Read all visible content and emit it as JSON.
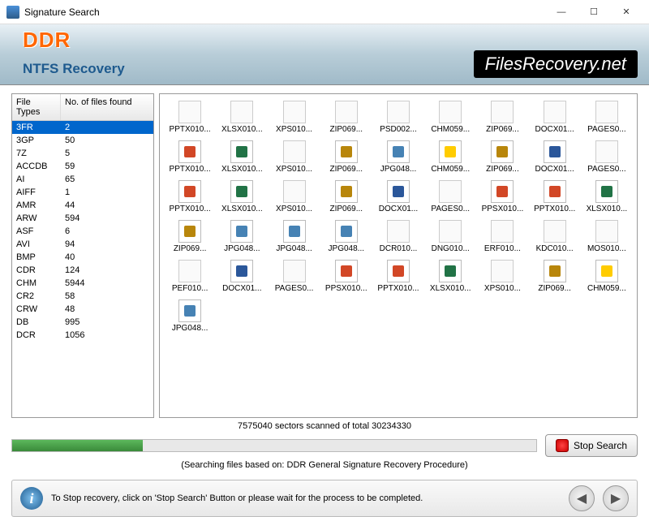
{
  "window": {
    "title": "Signature Search"
  },
  "brand": {
    "ddr": "DDR",
    "product": "NTFS Recovery",
    "site": "FilesRecovery.net"
  },
  "table": {
    "col1": "File Types",
    "col2": "No. of files found",
    "rows": [
      {
        "t": "3FR",
        "n": "2",
        "sel": true
      },
      {
        "t": "3GP",
        "n": "50"
      },
      {
        "t": "7Z",
        "n": "5"
      },
      {
        "t": "ACCDB",
        "n": "59"
      },
      {
        "t": "AI",
        "n": "65"
      },
      {
        "t": "AIFF",
        "n": "1"
      },
      {
        "t": "AMR",
        "n": "44"
      },
      {
        "t": "ARW",
        "n": "594"
      },
      {
        "t": "ASF",
        "n": "6"
      },
      {
        "t": "AVI",
        "n": "94"
      },
      {
        "t": "BMP",
        "n": "40"
      },
      {
        "t": "CDR",
        "n": "124"
      },
      {
        "t": "CHM",
        "n": "5944"
      },
      {
        "t": "CR2",
        "n": "58"
      },
      {
        "t": "CRW",
        "n": "48"
      },
      {
        "t": "DB",
        "n": "995"
      },
      {
        "t": "DCR",
        "n": "1056"
      }
    ]
  },
  "files": [
    {
      "n": "PPTX010...",
      "c": "blank"
    },
    {
      "n": "XLSX010...",
      "c": "blank"
    },
    {
      "n": "XPS010...",
      "c": "blank"
    },
    {
      "n": "ZIP069...",
      "c": "blank"
    },
    {
      "n": "PSD002...",
      "c": "blank"
    },
    {
      "n": "CHM059...",
      "c": "blank"
    },
    {
      "n": "ZIP069...",
      "c": "blank"
    },
    {
      "n": "DOCX01...",
      "c": "blank"
    },
    {
      "n": "PAGES0...",
      "c": "blank"
    },
    {
      "n": "PPTX010...",
      "c": "ppt"
    },
    {
      "n": "XLSX010...",
      "c": "xls"
    },
    {
      "n": "XPS010...",
      "c": "blank"
    },
    {
      "n": "ZIP069...",
      "c": "zip"
    },
    {
      "n": "JPG048...",
      "c": "jpg"
    },
    {
      "n": "CHM059...",
      "c": "chm"
    },
    {
      "n": "ZIP069...",
      "c": "zip"
    },
    {
      "n": "DOCX01...",
      "c": "doc"
    },
    {
      "n": "PAGES0...",
      "c": "blank"
    },
    {
      "n": "PPTX010...",
      "c": "ppt"
    },
    {
      "n": "XLSX010...",
      "c": "xls"
    },
    {
      "n": "XPS010...",
      "c": "blank"
    },
    {
      "n": "ZIP069...",
      "c": "zip"
    },
    {
      "n": "DOCX01...",
      "c": "doc"
    },
    {
      "n": "PAGES0...",
      "c": "blank"
    },
    {
      "n": "PPSX010...",
      "c": "ppt"
    },
    {
      "n": "PPTX010...",
      "c": "ppt"
    },
    {
      "n": "XLSX010...",
      "c": "xls"
    },
    {
      "n": "ZIP069...",
      "c": "zip"
    },
    {
      "n": "JPG048...",
      "c": "jpg"
    },
    {
      "n": "JPG048...",
      "c": "jpg"
    },
    {
      "n": "JPG048...",
      "c": "jpg"
    },
    {
      "n": "DCR010...",
      "c": "blank"
    },
    {
      "n": "DNG010...",
      "c": "blank"
    },
    {
      "n": "ERF010...",
      "c": "blank"
    },
    {
      "n": "KDC010...",
      "c": "blank"
    },
    {
      "n": "MOS010...",
      "c": "blank"
    },
    {
      "n": "PEF010...",
      "c": "blank"
    },
    {
      "n": "DOCX01...",
      "c": "doc"
    },
    {
      "n": "PAGES0...",
      "c": "blank"
    },
    {
      "n": "PPSX010...",
      "c": "ppt"
    },
    {
      "n": "PPTX010...",
      "c": "ppt"
    },
    {
      "n": "XLSX010...",
      "c": "xls"
    },
    {
      "n": "XPS010...",
      "c": "blank"
    },
    {
      "n": "ZIP069...",
      "c": "zip"
    },
    {
      "n": "CHM059...",
      "c": "chm"
    },
    {
      "n": "JPG048...",
      "c": "jpg"
    }
  ],
  "progress": {
    "status": "7575040 sectors scanned of total 30234330",
    "note": "(Searching files based on:  DDR General Signature Recovery Procedure)",
    "stop_label": "Stop Search",
    "percent": 25
  },
  "footer": {
    "text": "To Stop recovery, click on 'Stop Search' Button or please wait for the process to be completed."
  }
}
